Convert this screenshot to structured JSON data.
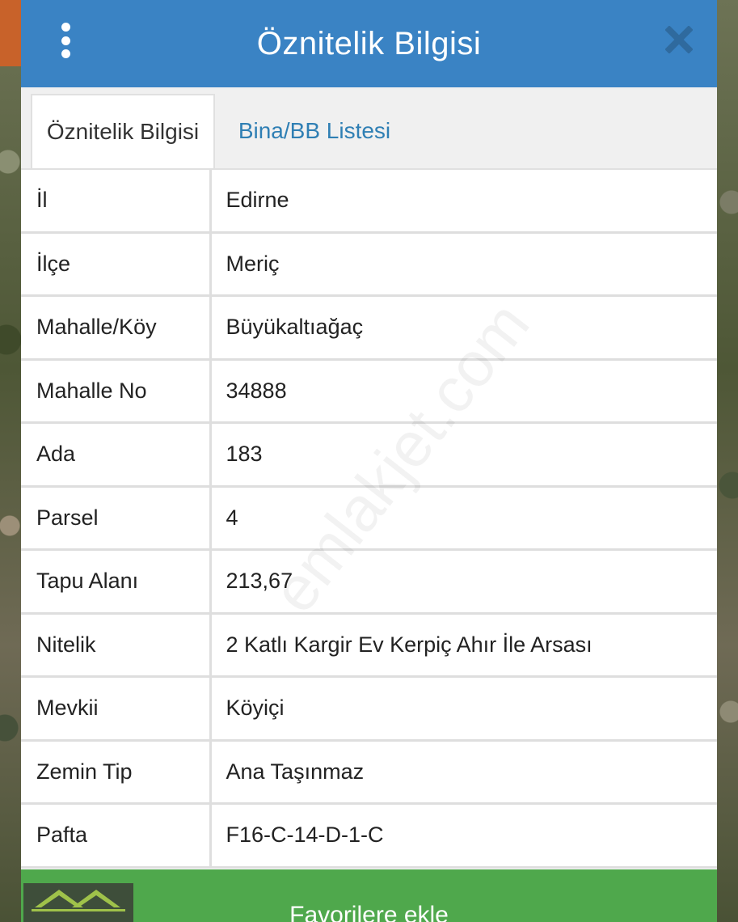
{
  "header": {
    "title": "Öznitelik Bilgisi"
  },
  "tabs": [
    {
      "label": "Öznitelik Bilgisi",
      "active": true
    },
    {
      "label": "Bina/BB Listesi",
      "active": false
    }
  ],
  "rows": [
    {
      "key": "İl",
      "value": "Edirne"
    },
    {
      "key": "İlçe",
      "value": "Meriç"
    },
    {
      "key": "Mahalle/Köy",
      "value": "Büyükaltıağaç"
    },
    {
      "key": "Mahalle No",
      "value": "34888"
    },
    {
      "key": "Ada",
      "value": "183"
    },
    {
      "key": "Parsel",
      "value": "4"
    },
    {
      "key": "Tapu Alanı",
      "value": "213,67"
    },
    {
      "key": "Nitelik",
      "value": "2 Katlı Kargir Ev Kerpiç Ahır İle Arsası"
    },
    {
      "key": "Mevkii",
      "value": "Köyiçi"
    },
    {
      "key": "Zemin Tip",
      "value": "Ana Taşınmaz"
    },
    {
      "key": "Pafta",
      "value": "F16-C-14-D-1-C"
    }
  ],
  "watermark": "emlakjet.com",
  "favorite_button": {
    "label": "Favorilere ekle"
  },
  "icons": {
    "menu": "more-vertical-icon",
    "close": "close-icon"
  },
  "colors": {
    "header": "#3a83c4",
    "tab_link": "#2f7fb4",
    "favorite": "#4fa84c"
  }
}
